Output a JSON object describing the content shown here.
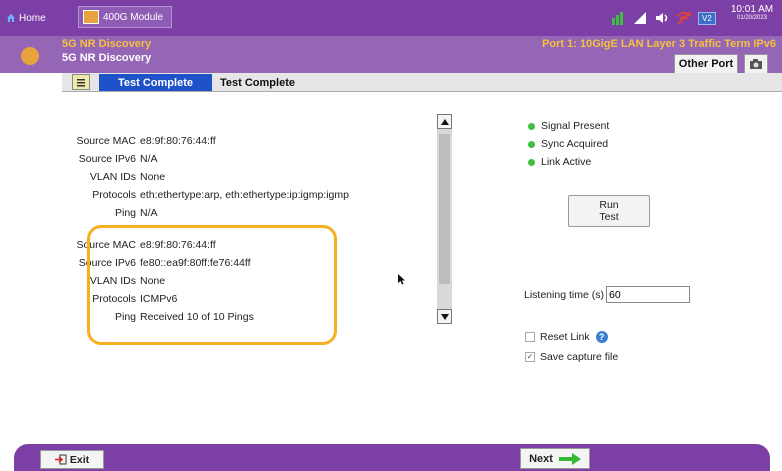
{
  "topbar": {
    "home_label": "Home",
    "module_label": "400G Module",
    "clock_time": "10:01 AM",
    "clock_date": "01/20/2023",
    "version_badge": "V2",
    "icons": [
      "module-icon",
      "signal-icon",
      "network-icon",
      "speaker-icon",
      "no-wifi-icon"
    ]
  },
  "header": {
    "title_top": "5G NR Discovery",
    "title_sub": "5G NR Discovery",
    "port_label": "Port 1: 10GigE LAN Layer 3 Traffic Term IPv6",
    "other_port_label": "Other Port",
    "accent_color": "#7b3fa6",
    "title_color": "#f6c040"
  },
  "tabs": {
    "active": "Test Complete",
    "second": "Test Complete"
  },
  "results": [
    {
      "rows": [
        {
          "label": "Source MAC",
          "value": "e8:9f:80:76:44:ff"
        },
        {
          "label": "Source IPv6",
          "value": "N/A"
        },
        {
          "label": "VLAN IDs",
          "value": "None"
        },
        {
          "label": "Protocols",
          "value": "eth:ethertype:arp, eth:ethertype:ip:igmp:igmp"
        },
        {
          "label": "Ping",
          "value": "N/A"
        }
      ]
    },
    {
      "rows": [
        {
          "label": "Source MAC",
          "value": "e8:9f:80:76:44:ff"
        },
        {
          "label": "Source IPv6",
          "value": "fe80::ea9f:80ff:fe76:44ff"
        },
        {
          "label": "VLAN IDs",
          "value": "None"
        },
        {
          "label": "Protocols",
          "value": "ICMPv6"
        },
        {
          "label": "Ping",
          "value": "Received 10 of 10 Pings"
        }
      ]
    }
  ],
  "indicators": [
    {
      "label": "Signal Present",
      "color": "#3fbf3f"
    },
    {
      "label": "Sync Acquired",
      "color": "#3fbf3f"
    },
    {
      "label": "Link Active",
      "color": "#3fbf3f"
    }
  ],
  "run_test_label": "Run\nTest",
  "listening": {
    "label": "Listening time (s)",
    "value": "60"
  },
  "options": {
    "reset_link": {
      "label": "Reset Link",
      "checked": false
    },
    "save_capture": {
      "label": "Save capture file",
      "checked": true
    }
  },
  "bottom": {
    "exit_label": "Exit",
    "next_label": "Next"
  },
  "highlight_color": "#f6b020"
}
